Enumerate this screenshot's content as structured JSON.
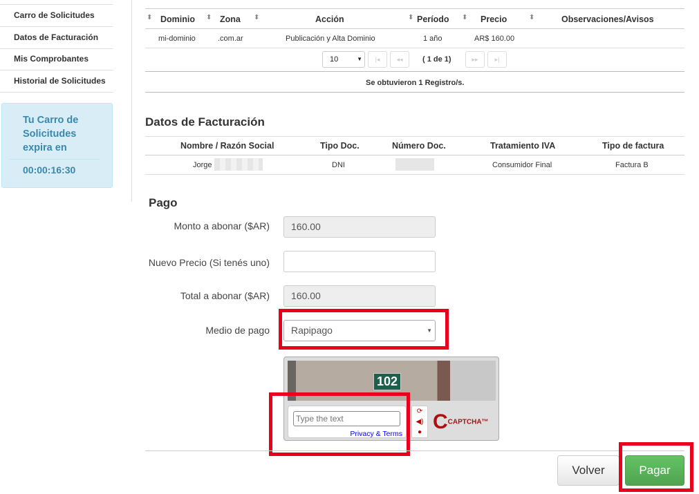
{
  "sidebar": {
    "items": [
      {
        "label": "Carro de Solicitudes"
      },
      {
        "label": "Datos de Facturación"
      },
      {
        "label": "Mis Comprobantes"
      },
      {
        "label": "Historial de Solicitudes"
      }
    ],
    "timer": {
      "text": "Tu Carro de Solicitudes expira en",
      "time": "00:00:16:30"
    }
  },
  "orders": {
    "headers": [
      "Dominio",
      "Zona",
      "Acción",
      "Período",
      "Precio",
      "Observaciones/Avisos"
    ],
    "row": [
      "mi-dominio",
      ".com.ar",
      "Publicación y Alta Dominio",
      "1 año",
      "AR$ 160.00",
      ""
    ],
    "page_size": "10",
    "page_info": "( 1 de 1)",
    "summary": "Se obtuvieron 1 Registro/s."
  },
  "billing": {
    "title": "Datos de Facturación",
    "headers": [
      "Nombre / Razón Social",
      "Tipo Doc.",
      "Número Doc.",
      "Tratamiento IVA",
      "Tipo de factura"
    ],
    "row": [
      "Jorge",
      "DNI",
      "",
      "Consumidor Final",
      "Factura B"
    ]
  },
  "payment": {
    "title": "Pago",
    "amount_label": "Monto a abonar ($AR)",
    "amount": "160.00",
    "new_price_label": "Nuevo Precio (Si tenés uno)",
    "new_price": "",
    "total_label": "Total a abonar ($AR)",
    "total": "160.00",
    "method_label": "Medio de pago",
    "method": "Rapipago"
  },
  "captcha": {
    "image_text": "102",
    "placeholder": "Type the text",
    "privacy": "Privacy & Terms",
    "logo": "reCAPTCHA™"
  },
  "actions": {
    "back": "Volver",
    "pay": "Pagar"
  },
  "colors": {
    "highlight": "#e8001c",
    "pay": "#5cb85c",
    "timer_bg": "#d9edf7"
  }
}
